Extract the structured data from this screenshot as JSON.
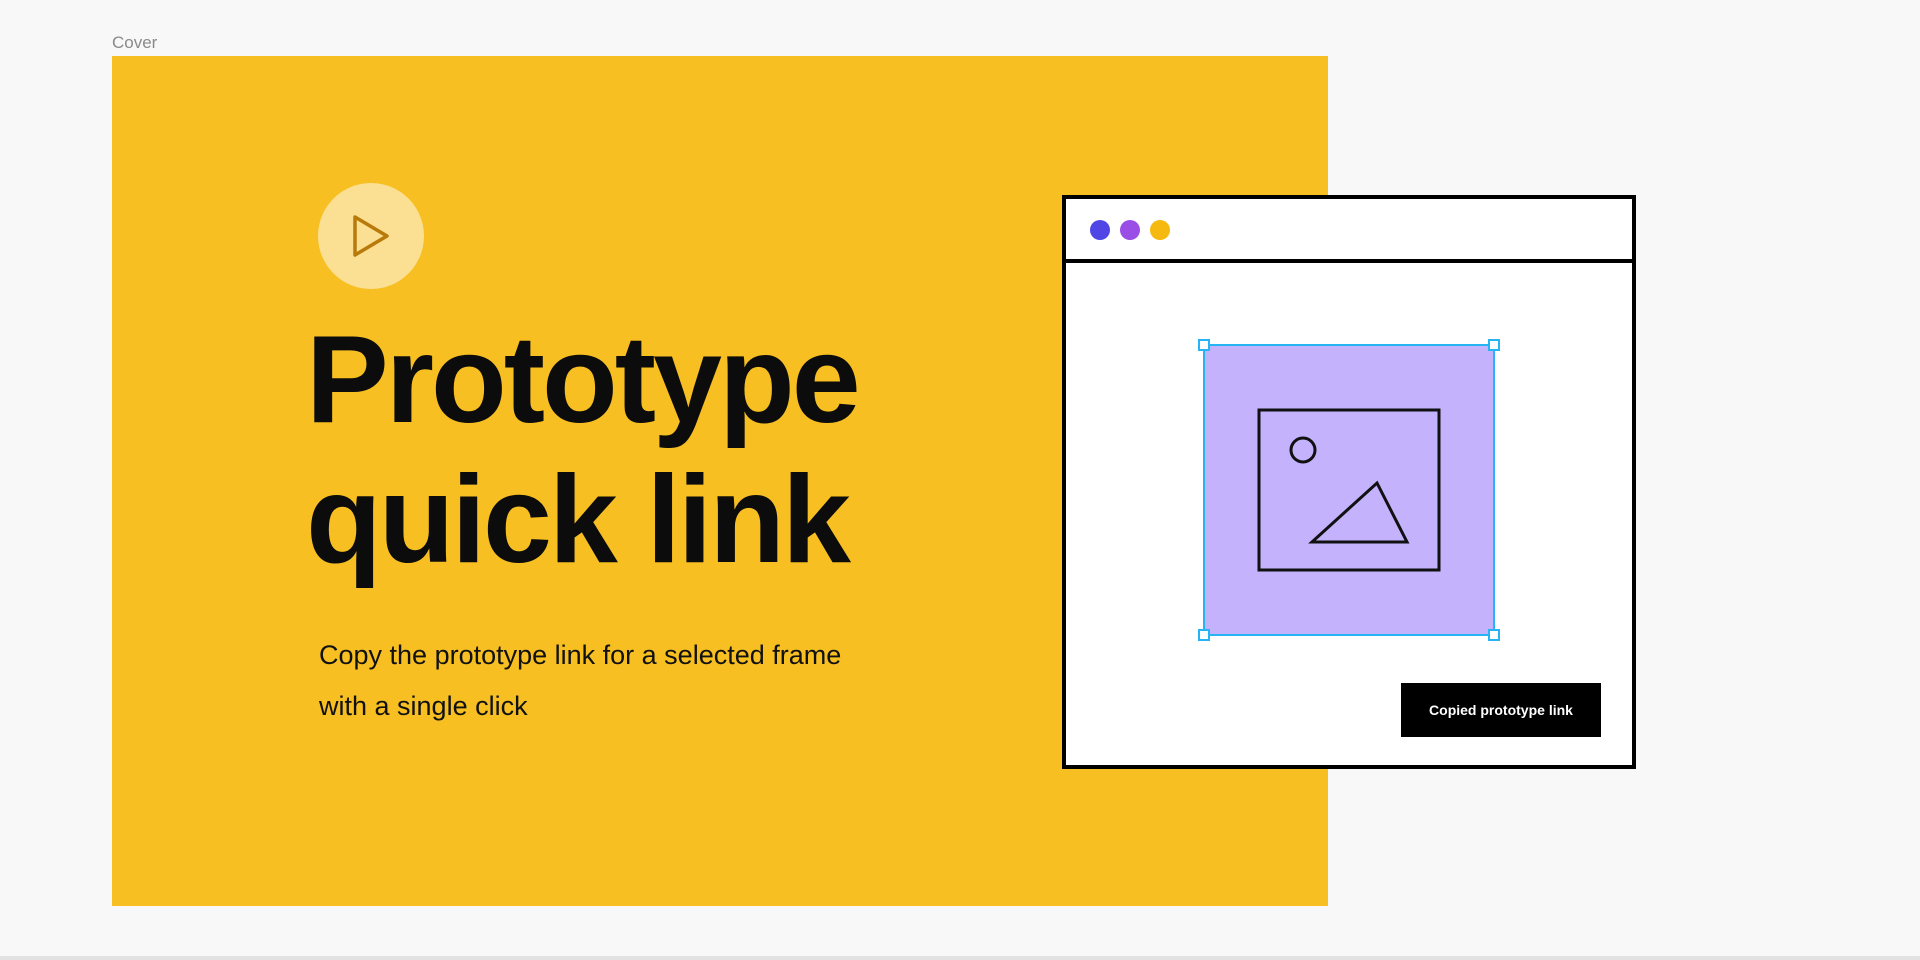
{
  "frame": {
    "label": "Cover",
    "background_color": "#f7bf21"
  },
  "cover": {
    "icon": "play-icon",
    "headline_lines": [
      "Prototype",
      "quick link"
    ],
    "subtitle_lines": [
      "Copy the prototype link for a selected frame",
      "with a single click"
    ]
  },
  "mock_window": {
    "window_dots": [
      {
        "name": "blue",
        "color": "#4f46e5"
      },
      {
        "name": "purple",
        "color": "#9a4ee6"
      },
      {
        "name": "yellow",
        "color": "#f5b910"
      }
    ],
    "selected_frame_icon": "image-icon",
    "selected_frame_fill": "#c4b2fc",
    "selection_color": "#27b4f5",
    "toast_text": "Copied prototype link"
  }
}
